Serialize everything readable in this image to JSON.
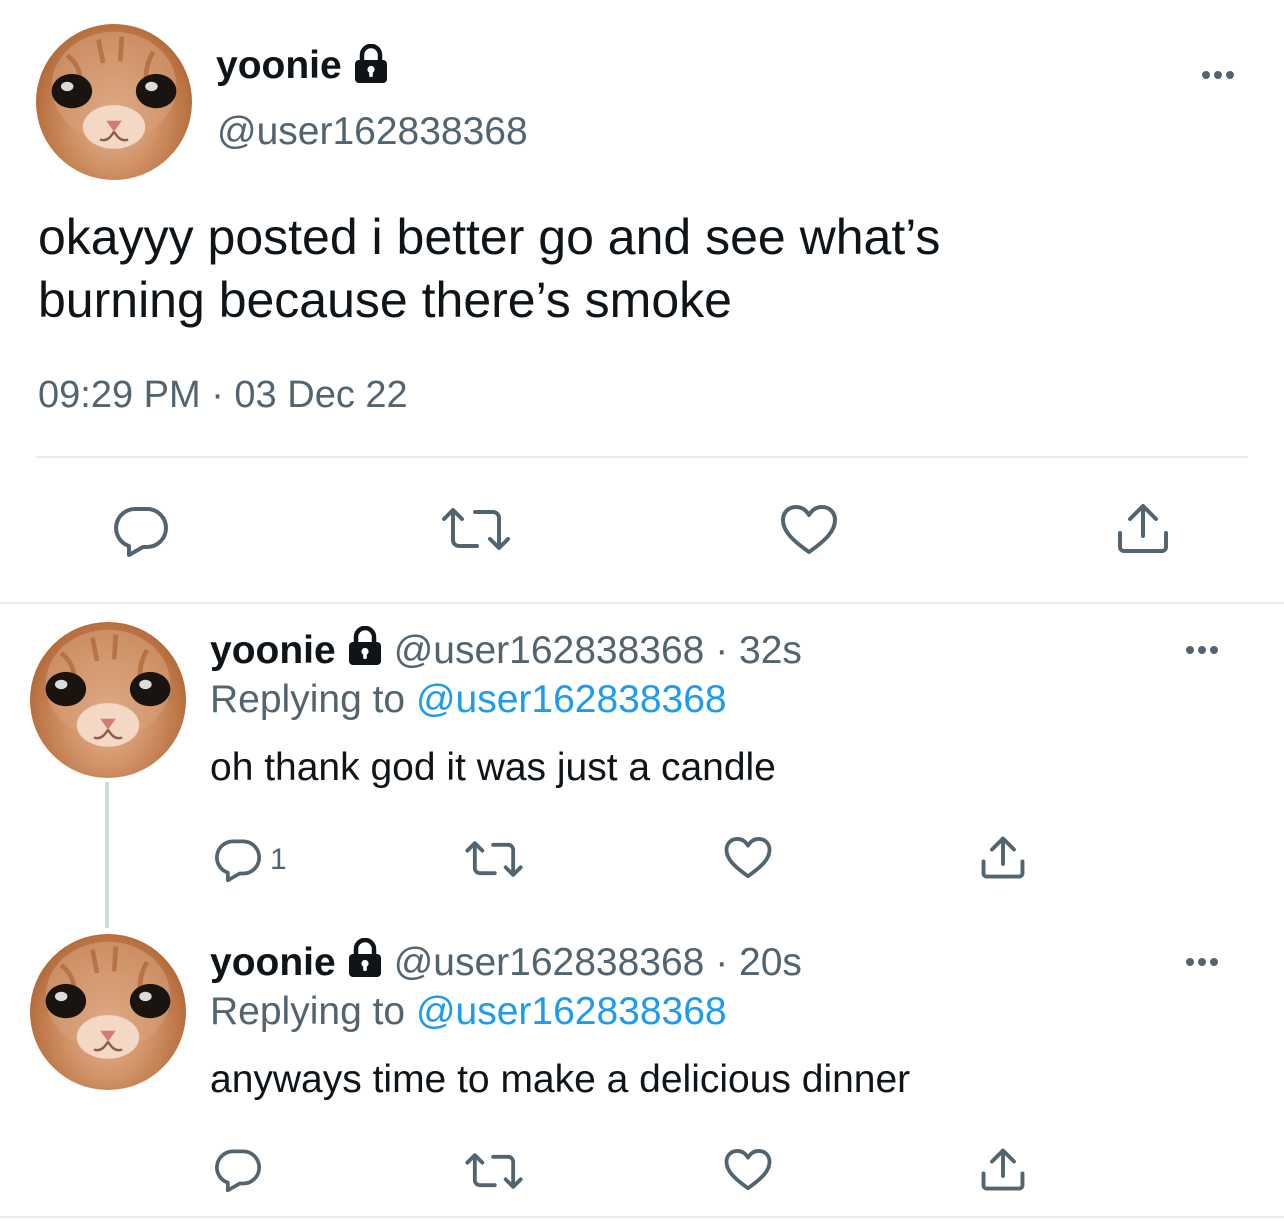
{
  "main_tweet": {
    "display_name": "yoonie",
    "handle": "@user162838368",
    "text_line1": "okayyy posted i better go and see what’s",
    "text_line2": "burning because there’s smoke",
    "timestamp": "09:29 PM · 03 Dec 22"
  },
  "replies": [
    {
      "display_name": "yoonie",
      "handle_time": "@user162838368 · 32s",
      "replying_prefix": "Replying to ",
      "replying_handle": "@user162838368",
      "text": "oh thank god it was just a candle",
      "reply_count": "1"
    },
    {
      "display_name": "yoonie",
      "handle_time": "@user162838368 · 20s",
      "replying_prefix": "Replying to ",
      "replying_handle": "@user162838368",
      "text": "anyways time to make a delicious dinner",
      "reply_count": ""
    }
  ],
  "icons": {
    "reply": "comment-bubble-icon",
    "retweet": "retweet-arrows-icon",
    "like": "heart-outline-icon",
    "share": "share-upload-icon",
    "more": "more-dots-icon",
    "protected": "lock-icon"
  },
  "colors": {
    "text": "#0f1419",
    "secondary": "#536471",
    "link": "#1d9bf0",
    "divider": "#e6ecf0"
  }
}
